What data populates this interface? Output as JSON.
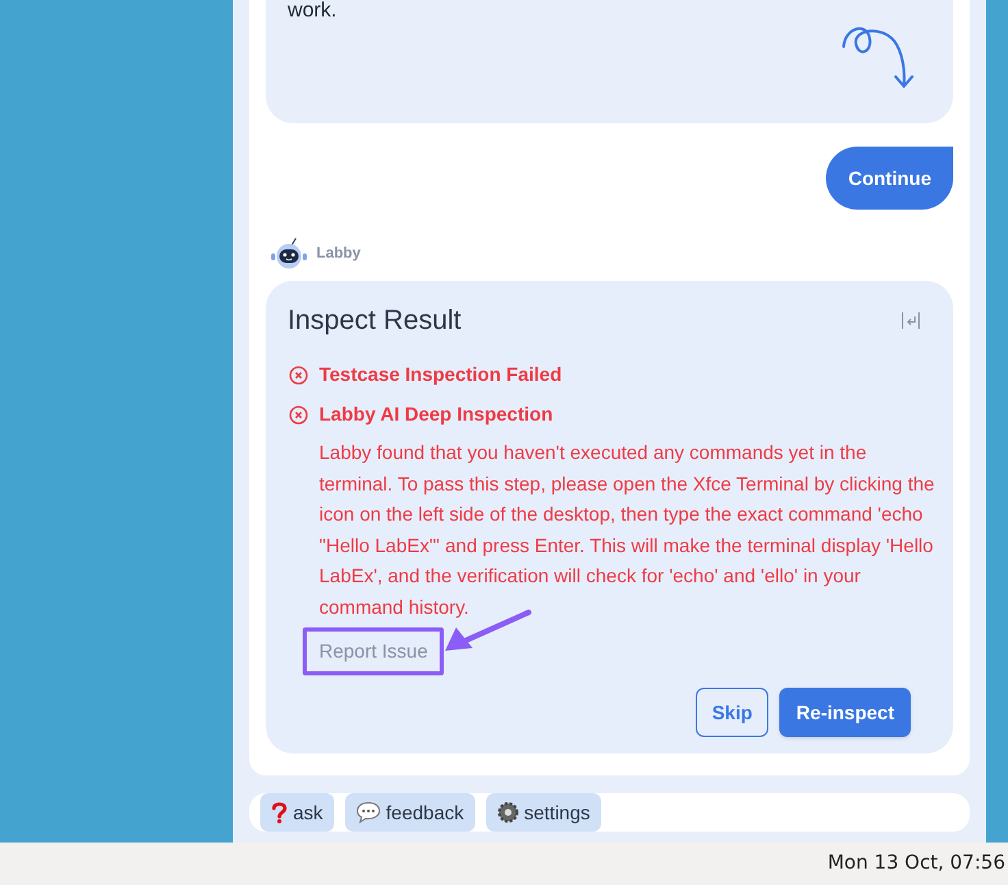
{
  "message_bubble": {
    "text": "work."
  },
  "continue_button": "Continue",
  "assistant": {
    "name": "Labby"
  },
  "inspect_result": {
    "title": "Inspect Result",
    "checks": [
      {
        "label": "Testcase Inspection Failed",
        "failed": true
      },
      {
        "label": "Labby AI Deep Inspection",
        "failed": true,
        "detail": "Labby found that you haven't executed any commands yet in the terminal. To pass this step, please open the Xfce Terminal by clicking the icon on the left side of the desktop, then type the exact command 'echo \"Hello LabEx\"' and press Enter. This will make the terminal display 'Hello LabEx', and the verification will check for 'echo' and 'ello' in your command history."
      }
    ],
    "report_link": "Report Issue",
    "buttons": [
      {
        "label": "Skip",
        "kind": "outline"
      },
      {
        "label": "Re-inspect",
        "kind": "primary"
      }
    ]
  },
  "toolbar": [
    {
      "label": "ask",
      "kind": "question"
    },
    {
      "label": "feedback",
      "kind": "speech"
    },
    {
      "label": "settings",
      "kind": "gear"
    }
  ],
  "taskbar": {
    "clock": "Mon 13 Oct, 07:56"
  }
}
